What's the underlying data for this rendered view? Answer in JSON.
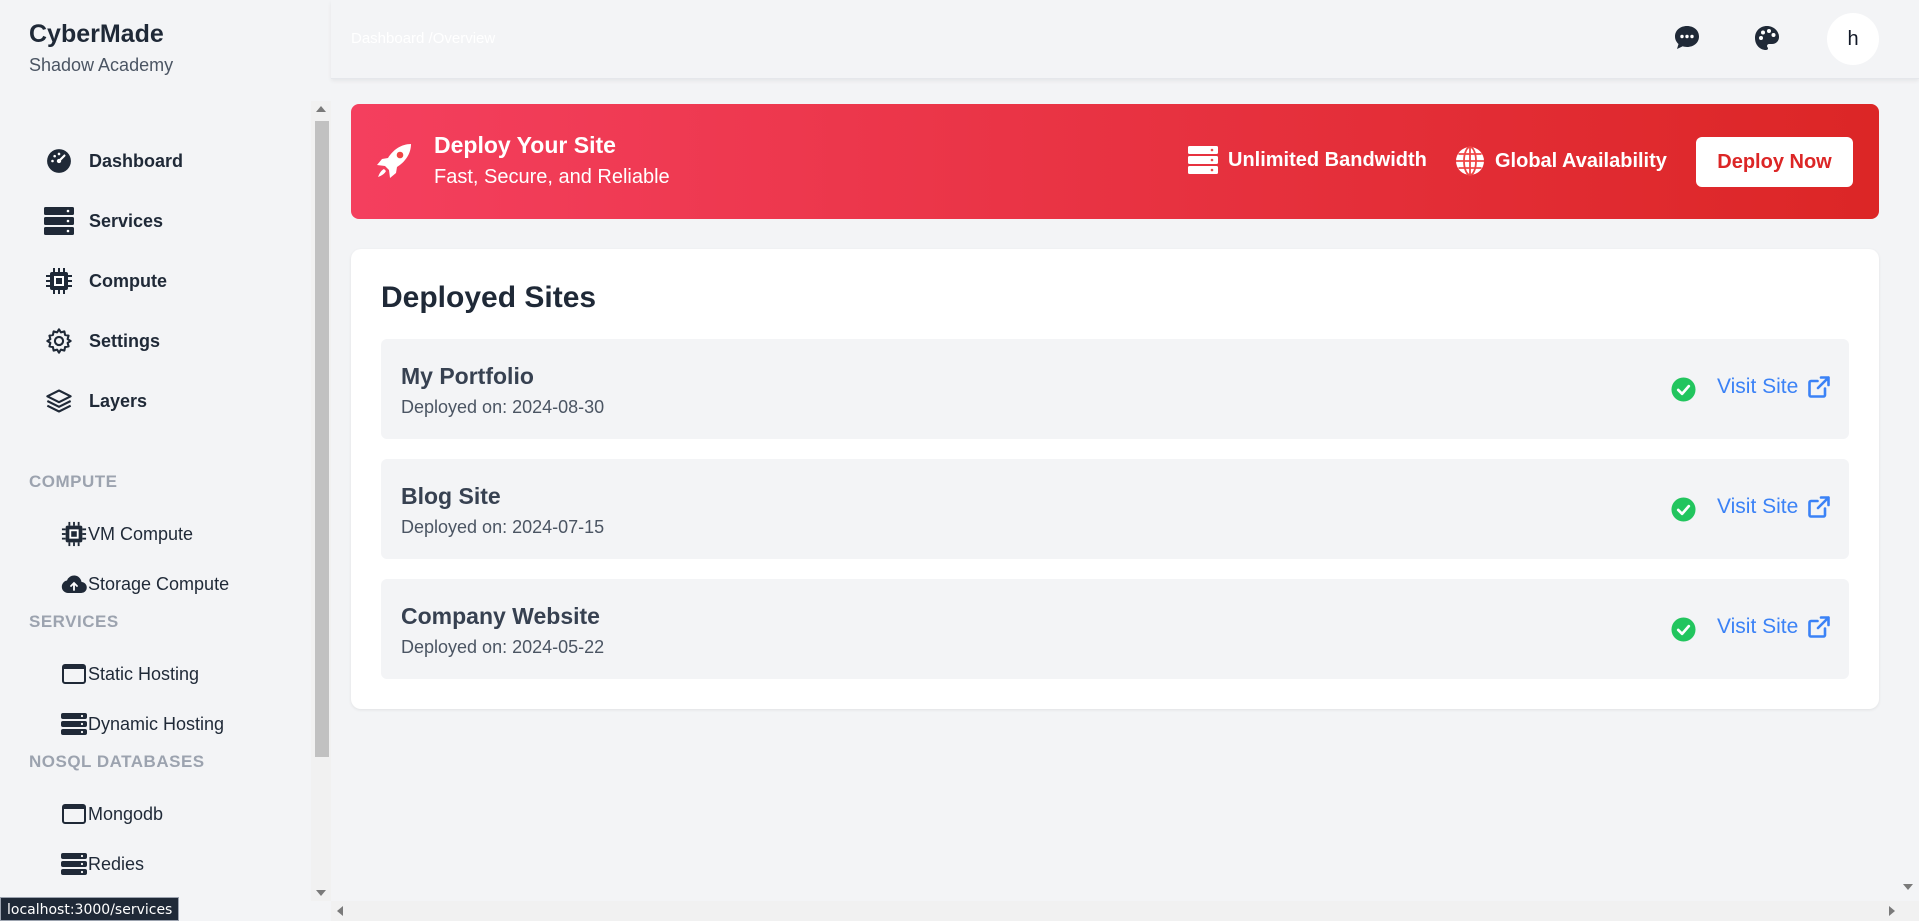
{
  "brand": {
    "title": "CyberMade",
    "subtitle": "Shadow Academy"
  },
  "nav": [
    {
      "label": "Dashboard",
      "icon": "gauge-icon"
    },
    {
      "label": "Services",
      "icon": "server-icon"
    },
    {
      "label": "Compute",
      "icon": "cpu-icon"
    },
    {
      "label": "Settings",
      "icon": "gear-icon"
    },
    {
      "label": "Layers",
      "icon": "layers-icon"
    }
  ],
  "sections": [
    {
      "heading": "COMPUTE",
      "items": [
        {
          "label": "VM Compute",
          "icon": "cpu-icon"
        },
        {
          "label": "Storage Compute",
          "icon": "cloud-upload-icon"
        }
      ]
    },
    {
      "heading": "SERVICES",
      "items": [
        {
          "label": "Static Hosting",
          "icon": "window-icon"
        },
        {
          "label": "Dynamic Hosting",
          "icon": "database-icon"
        }
      ]
    },
    {
      "heading": "NOSQL DATABASES",
      "items": [
        {
          "label": "Mongodb",
          "icon": "window-icon"
        },
        {
          "label": "Redies",
          "icon": "database-icon"
        }
      ]
    }
  ],
  "header": {
    "breadcrumb": "Dashboard /Overview",
    "avatar_initial": "h"
  },
  "banner": {
    "title": "Deploy Your Site",
    "subtitle": "Fast, Secure, and Reliable",
    "features": [
      "Unlimited Bandwidth",
      "Global Availability"
    ],
    "button": "Deploy Now",
    "gradient_start": "#f43f5e",
    "gradient_end": "#dc2626"
  },
  "deployed": {
    "title": "Deployed Sites",
    "visit_label": "Visit Site",
    "sites": [
      {
        "name": "My Portfolio",
        "date": "Deployed on: 2024-08-30"
      },
      {
        "name": "Blog Site",
        "date": "Deployed on: 2024-07-15"
      },
      {
        "name": "Company Website",
        "date": "Deployed on: 2024-05-22"
      }
    ]
  },
  "status_bar": {
    "url": "localhost:3000/services"
  },
  "colors": {
    "accent": "#3b82f6",
    "success": "#22c55e",
    "danger": "#dc2626"
  }
}
